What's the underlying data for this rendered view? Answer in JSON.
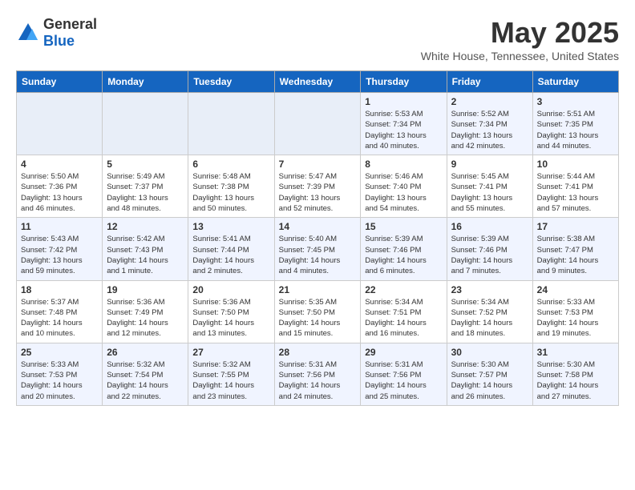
{
  "logo": {
    "general": "General",
    "blue": "Blue"
  },
  "header": {
    "month": "May 2025",
    "location": "White House, Tennessee, United States"
  },
  "weekdays": [
    "Sunday",
    "Monday",
    "Tuesday",
    "Wednesday",
    "Thursday",
    "Friday",
    "Saturday"
  ],
  "weeks": [
    [
      {
        "day": "",
        "info": ""
      },
      {
        "day": "",
        "info": ""
      },
      {
        "day": "",
        "info": ""
      },
      {
        "day": "",
        "info": ""
      },
      {
        "day": "1",
        "info": "Sunrise: 5:53 AM\nSunset: 7:34 PM\nDaylight: 13 hours\nand 40 minutes."
      },
      {
        "day": "2",
        "info": "Sunrise: 5:52 AM\nSunset: 7:34 PM\nDaylight: 13 hours\nand 42 minutes."
      },
      {
        "day": "3",
        "info": "Sunrise: 5:51 AM\nSunset: 7:35 PM\nDaylight: 13 hours\nand 44 minutes."
      }
    ],
    [
      {
        "day": "4",
        "info": "Sunrise: 5:50 AM\nSunset: 7:36 PM\nDaylight: 13 hours\nand 46 minutes."
      },
      {
        "day": "5",
        "info": "Sunrise: 5:49 AM\nSunset: 7:37 PM\nDaylight: 13 hours\nand 48 minutes."
      },
      {
        "day": "6",
        "info": "Sunrise: 5:48 AM\nSunset: 7:38 PM\nDaylight: 13 hours\nand 50 minutes."
      },
      {
        "day": "7",
        "info": "Sunrise: 5:47 AM\nSunset: 7:39 PM\nDaylight: 13 hours\nand 52 minutes."
      },
      {
        "day": "8",
        "info": "Sunrise: 5:46 AM\nSunset: 7:40 PM\nDaylight: 13 hours\nand 54 minutes."
      },
      {
        "day": "9",
        "info": "Sunrise: 5:45 AM\nSunset: 7:41 PM\nDaylight: 13 hours\nand 55 minutes."
      },
      {
        "day": "10",
        "info": "Sunrise: 5:44 AM\nSunset: 7:41 PM\nDaylight: 13 hours\nand 57 minutes."
      }
    ],
    [
      {
        "day": "11",
        "info": "Sunrise: 5:43 AM\nSunset: 7:42 PM\nDaylight: 13 hours\nand 59 minutes."
      },
      {
        "day": "12",
        "info": "Sunrise: 5:42 AM\nSunset: 7:43 PM\nDaylight: 14 hours\nand 1 minute."
      },
      {
        "day": "13",
        "info": "Sunrise: 5:41 AM\nSunset: 7:44 PM\nDaylight: 14 hours\nand 2 minutes."
      },
      {
        "day": "14",
        "info": "Sunrise: 5:40 AM\nSunset: 7:45 PM\nDaylight: 14 hours\nand 4 minutes."
      },
      {
        "day": "15",
        "info": "Sunrise: 5:39 AM\nSunset: 7:46 PM\nDaylight: 14 hours\nand 6 minutes."
      },
      {
        "day": "16",
        "info": "Sunrise: 5:39 AM\nSunset: 7:46 PM\nDaylight: 14 hours\nand 7 minutes."
      },
      {
        "day": "17",
        "info": "Sunrise: 5:38 AM\nSunset: 7:47 PM\nDaylight: 14 hours\nand 9 minutes."
      }
    ],
    [
      {
        "day": "18",
        "info": "Sunrise: 5:37 AM\nSunset: 7:48 PM\nDaylight: 14 hours\nand 10 minutes."
      },
      {
        "day": "19",
        "info": "Sunrise: 5:36 AM\nSunset: 7:49 PM\nDaylight: 14 hours\nand 12 minutes."
      },
      {
        "day": "20",
        "info": "Sunrise: 5:36 AM\nSunset: 7:50 PM\nDaylight: 14 hours\nand 13 minutes."
      },
      {
        "day": "21",
        "info": "Sunrise: 5:35 AM\nSunset: 7:50 PM\nDaylight: 14 hours\nand 15 minutes."
      },
      {
        "day": "22",
        "info": "Sunrise: 5:34 AM\nSunset: 7:51 PM\nDaylight: 14 hours\nand 16 minutes."
      },
      {
        "day": "23",
        "info": "Sunrise: 5:34 AM\nSunset: 7:52 PM\nDaylight: 14 hours\nand 18 minutes."
      },
      {
        "day": "24",
        "info": "Sunrise: 5:33 AM\nSunset: 7:53 PM\nDaylight: 14 hours\nand 19 minutes."
      }
    ],
    [
      {
        "day": "25",
        "info": "Sunrise: 5:33 AM\nSunset: 7:53 PM\nDaylight: 14 hours\nand 20 minutes."
      },
      {
        "day": "26",
        "info": "Sunrise: 5:32 AM\nSunset: 7:54 PM\nDaylight: 14 hours\nand 22 minutes."
      },
      {
        "day": "27",
        "info": "Sunrise: 5:32 AM\nSunset: 7:55 PM\nDaylight: 14 hours\nand 23 minutes."
      },
      {
        "day": "28",
        "info": "Sunrise: 5:31 AM\nSunset: 7:56 PM\nDaylight: 14 hours\nand 24 minutes."
      },
      {
        "day": "29",
        "info": "Sunrise: 5:31 AM\nSunset: 7:56 PM\nDaylight: 14 hours\nand 25 minutes."
      },
      {
        "day": "30",
        "info": "Sunrise: 5:30 AM\nSunset: 7:57 PM\nDaylight: 14 hours\nand 26 minutes."
      },
      {
        "day": "31",
        "info": "Sunrise: 5:30 AM\nSunset: 7:58 PM\nDaylight: 14 hours\nand 27 minutes."
      }
    ]
  ]
}
